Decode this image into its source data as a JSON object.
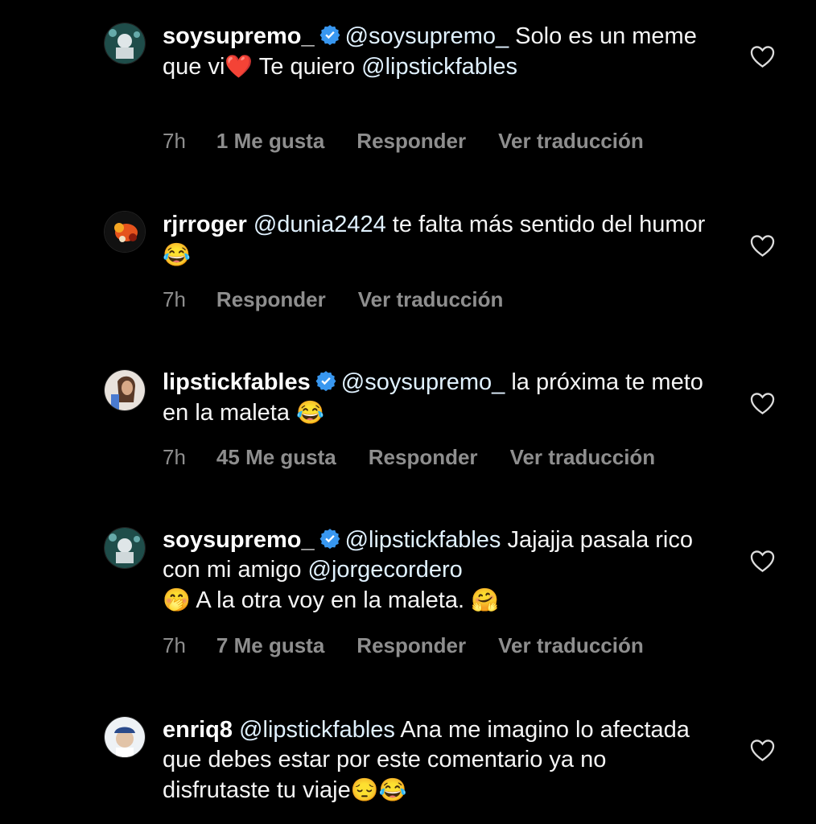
{
  "comments": [
    {
      "username": "soysupremo_",
      "verified": true,
      "mention": "@soysupremo_",
      "text1": " Solo es un meme que vi",
      "emoji1": "❤️",
      "text2": " Te quiero ",
      "mention2": "@lipstickfables",
      "time": "7h",
      "likes": "1 Me gusta",
      "reply": "Responder",
      "translate": "Ver traducción"
    },
    {
      "username": "rjrroger",
      "verified": false,
      "mention": "@dunia2424",
      "text1": " te falta más sentido del humor ",
      "emoji1": "😂",
      "time": "7h",
      "reply": "Responder",
      "translate": "Ver traducción"
    },
    {
      "username": "lipstickfables",
      "verified": true,
      "mention": "@soysupremo_",
      "text1": " la próxima te meto en la maleta ",
      "emoji1": "😂",
      "time": "7h",
      "likes": "45 Me gusta",
      "reply": "Responder",
      "translate": "Ver traducción"
    },
    {
      "username": "soysupremo_",
      "verified": true,
      "mention": "@lipstickfables",
      "text1": " Jajajja pasala rico con mi amigo ",
      "mention2": "@jorgecordero",
      "emoji1": "🤭",
      "text2": "  A la otra voy en la maleta. ",
      "emoji2": "🤗",
      "time": "7h",
      "likes": "7 Me gusta",
      "reply": "Responder",
      "translate": "Ver traducción"
    },
    {
      "username": "enriq8",
      "verified": false,
      "mention": "@lipstickfables",
      "text1": " Ana me imagino lo afectada que debes estar por este comentario ya no disfrutaste tu viaje",
      "emoji1": "😔",
      "emoji2": "😂"
    }
  ],
  "colors": {
    "background": "#000000",
    "text": "#f5f5f5",
    "mention": "#e0f1ff",
    "meta": "#8e8e8e",
    "verified": "#3897f0"
  },
  "icons": {
    "like": "heart-outline-icon",
    "verified": "verified-badge-icon"
  }
}
